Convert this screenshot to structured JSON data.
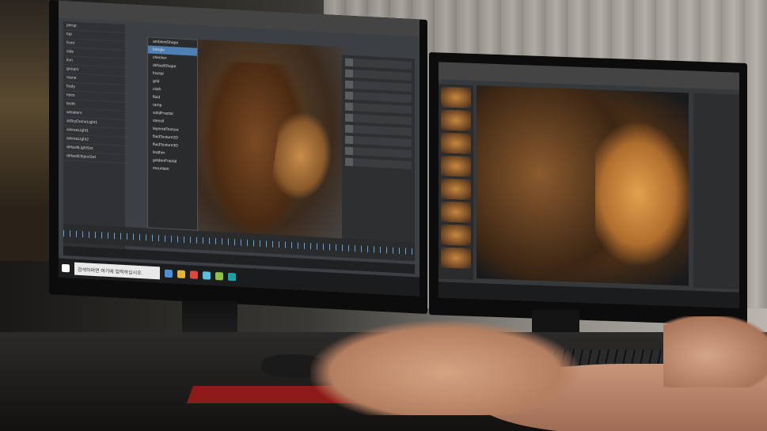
{
  "scene": {
    "type": "photo",
    "description_tags": [
      "dual-monitors",
      "3d-software",
      "lion-model",
      "hands",
      "keyboard",
      "mouse"
    ]
  },
  "monitor_left": {
    "taskbar": {
      "search_placeholder": "검색하려면 여기에 입력하십시오."
    },
    "popup_items": [
      "ambientShape",
      "bangle",
      "checker",
      "defaultShape",
      "fractal",
      "grid",
      "cloth",
      "fluid",
      "ramp",
      "solidFractal",
      "stencil",
      "layeredTexture",
      "fluidTexture2D",
      "fluidTexture3D",
      "leather",
      "goldenFractal",
      "mountain"
    ],
    "outliner_items": [
      "persp",
      "top",
      "front",
      "side",
      "lion",
      "group1",
      "mane",
      "body",
      "eyes",
      "teeth",
      "whiskers",
      "aiSkyDomeLight1",
      "aiAreaLight1",
      "aiAreaLight2",
      "defaultLightSet",
      "defaultObjectSet"
    ]
  },
  "monitor_right": {
    "thumbnails_count": 9
  }
}
